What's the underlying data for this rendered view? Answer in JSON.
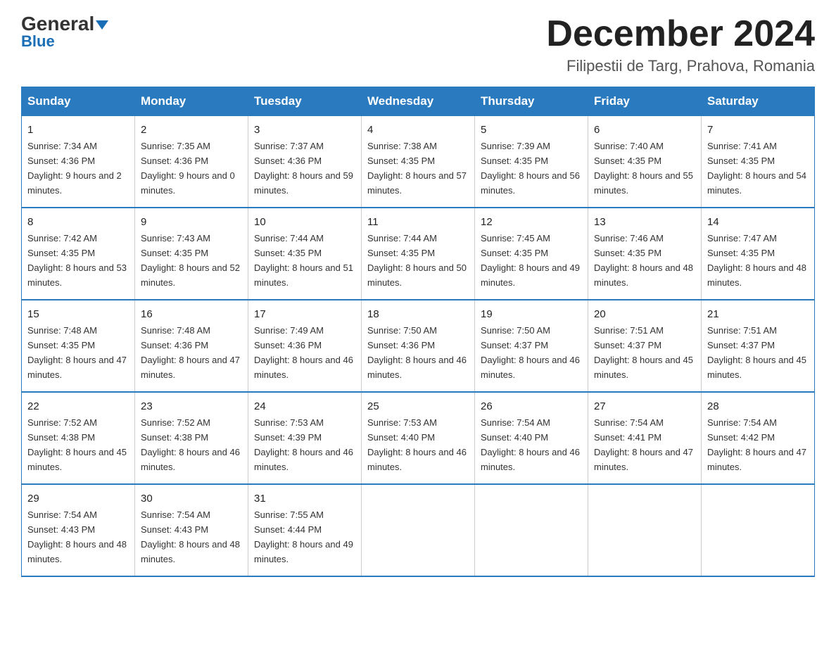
{
  "header": {
    "logo_general": "General",
    "logo_blue": "Blue",
    "month_title": "December 2024",
    "location": "Filipestii de Targ, Prahova, Romania"
  },
  "days_of_week": [
    "Sunday",
    "Monday",
    "Tuesday",
    "Wednesday",
    "Thursday",
    "Friday",
    "Saturday"
  ],
  "weeks": [
    [
      {
        "num": "1",
        "sunrise": "7:34 AM",
        "sunset": "4:36 PM",
        "daylight": "9 hours and 2 minutes."
      },
      {
        "num": "2",
        "sunrise": "7:35 AM",
        "sunset": "4:36 PM",
        "daylight": "9 hours and 0 minutes."
      },
      {
        "num": "3",
        "sunrise": "7:37 AM",
        "sunset": "4:36 PM",
        "daylight": "8 hours and 59 minutes."
      },
      {
        "num": "4",
        "sunrise": "7:38 AM",
        "sunset": "4:35 PM",
        "daylight": "8 hours and 57 minutes."
      },
      {
        "num": "5",
        "sunrise": "7:39 AM",
        "sunset": "4:35 PM",
        "daylight": "8 hours and 56 minutes."
      },
      {
        "num": "6",
        "sunrise": "7:40 AM",
        "sunset": "4:35 PM",
        "daylight": "8 hours and 55 minutes."
      },
      {
        "num": "7",
        "sunrise": "7:41 AM",
        "sunset": "4:35 PM",
        "daylight": "8 hours and 54 minutes."
      }
    ],
    [
      {
        "num": "8",
        "sunrise": "7:42 AM",
        "sunset": "4:35 PM",
        "daylight": "8 hours and 53 minutes."
      },
      {
        "num": "9",
        "sunrise": "7:43 AM",
        "sunset": "4:35 PM",
        "daylight": "8 hours and 52 minutes."
      },
      {
        "num": "10",
        "sunrise": "7:44 AM",
        "sunset": "4:35 PM",
        "daylight": "8 hours and 51 minutes."
      },
      {
        "num": "11",
        "sunrise": "7:44 AM",
        "sunset": "4:35 PM",
        "daylight": "8 hours and 50 minutes."
      },
      {
        "num": "12",
        "sunrise": "7:45 AM",
        "sunset": "4:35 PM",
        "daylight": "8 hours and 49 minutes."
      },
      {
        "num": "13",
        "sunrise": "7:46 AM",
        "sunset": "4:35 PM",
        "daylight": "8 hours and 48 minutes."
      },
      {
        "num": "14",
        "sunrise": "7:47 AM",
        "sunset": "4:35 PM",
        "daylight": "8 hours and 48 minutes."
      }
    ],
    [
      {
        "num": "15",
        "sunrise": "7:48 AM",
        "sunset": "4:35 PM",
        "daylight": "8 hours and 47 minutes."
      },
      {
        "num": "16",
        "sunrise": "7:48 AM",
        "sunset": "4:36 PM",
        "daylight": "8 hours and 47 minutes."
      },
      {
        "num": "17",
        "sunrise": "7:49 AM",
        "sunset": "4:36 PM",
        "daylight": "8 hours and 46 minutes."
      },
      {
        "num": "18",
        "sunrise": "7:50 AM",
        "sunset": "4:36 PM",
        "daylight": "8 hours and 46 minutes."
      },
      {
        "num": "19",
        "sunrise": "7:50 AM",
        "sunset": "4:37 PM",
        "daylight": "8 hours and 46 minutes."
      },
      {
        "num": "20",
        "sunrise": "7:51 AM",
        "sunset": "4:37 PM",
        "daylight": "8 hours and 45 minutes."
      },
      {
        "num": "21",
        "sunrise": "7:51 AM",
        "sunset": "4:37 PM",
        "daylight": "8 hours and 45 minutes."
      }
    ],
    [
      {
        "num": "22",
        "sunrise": "7:52 AM",
        "sunset": "4:38 PM",
        "daylight": "8 hours and 45 minutes."
      },
      {
        "num": "23",
        "sunrise": "7:52 AM",
        "sunset": "4:38 PM",
        "daylight": "8 hours and 46 minutes."
      },
      {
        "num": "24",
        "sunrise": "7:53 AM",
        "sunset": "4:39 PM",
        "daylight": "8 hours and 46 minutes."
      },
      {
        "num": "25",
        "sunrise": "7:53 AM",
        "sunset": "4:40 PM",
        "daylight": "8 hours and 46 minutes."
      },
      {
        "num": "26",
        "sunrise": "7:54 AM",
        "sunset": "4:40 PM",
        "daylight": "8 hours and 46 minutes."
      },
      {
        "num": "27",
        "sunrise": "7:54 AM",
        "sunset": "4:41 PM",
        "daylight": "8 hours and 47 minutes."
      },
      {
        "num": "28",
        "sunrise": "7:54 AM",
        "sunset": "4:42 PM",
        "daylight": "8 hours and 47 minutes."
      }
    ],
    [
      {
        "num": "29",
        "sunrise": "7:54 AM",
        "sunset": "4:43 PM",
        "daylight": "8 hours and 48 minutes."
      },
      {
        "num": "30",
        "sunrise": "7:54 AM",
        "sunset": "4:43 PM",
        "daylight": "8 hours and 48 minutes."
      },
      {
        "num": "31",
        "sunrise": "7:55 AM",
        "sunset": "4:44 PM",
        "daylight": "8 hours and 49 minutes."
      },
      null,
      null,
      null,
      null
    ]
  ]
}
